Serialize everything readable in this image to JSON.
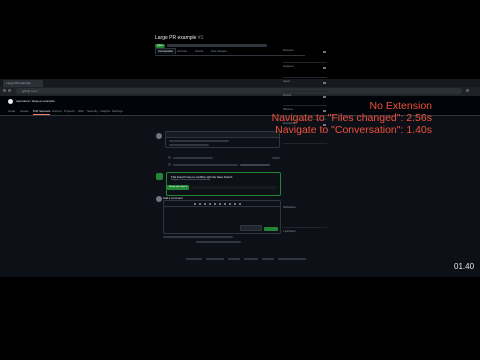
{
  "browser": {
    "tab_title": "Large PR example",
    "address": "github.com/"
  },
  "header": {
    "repo_path": "reponame / large-pr-example"
  },
  "repo_tabs": [
    "Code",
    "Issues",
    "Pull requests",
    "Actions",
    "Projects",
    "Wiki",
    "Security",
    "Insights",
    "Settings"
  ],
  "pr": {
    "title": "Large PR example",
    "number": "#1",
    "state_badge": "Open",
    "tabs": [
      "Conversation",
      "Commits",
      "Checks",
      "Files changed"
    ]
  },
  "merge": {
    "title": "This branch has no conflicts with the base branch",
    "subtitle": "Merging can be performed automatically.",
    "button": "Merge pull request"
  },
  "comment": {
    "label": "Add a comment"
  },
  "sidebar": {
    "labels": [
      "Reviewers",
      "Assignees",
      "Labels",
      "Projects",
      "Milestone",
      "Development",
      "Notifications",
      "1 participant"
    ]
  },
  "overlay": {
    "line1": "No Extension",
    "line2": "Navigate to \"Files changed\": 2.56s",
    "line3": "Navigate to \"Conversation\": 1.40s"
  },
  "timer": "01.40",
  "colors": {
    "overlay_text": "#f0503c",
    "merge_green": "#238636",
    "background": "#0d1117"
  }
}
